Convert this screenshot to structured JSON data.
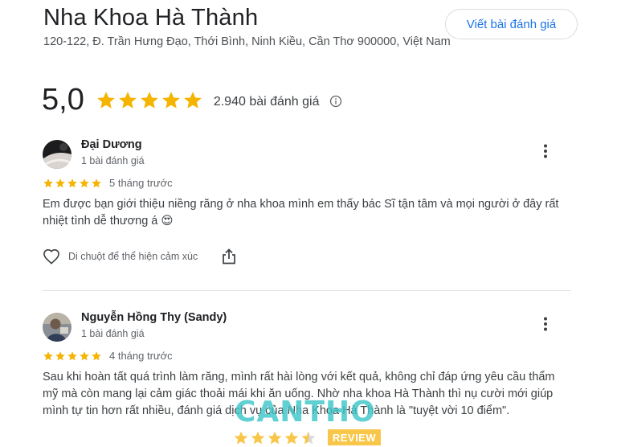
{
  "business": {
    "name": "Nha Khoa Hà Thành",
    "address": "120-122, Đ. Trần Hưng Đạo, Thới Bình, Ninh Kiều, Cần Thơ 900000, Việt Nam",
    "write_review_label": "Viết bài đánh giá",
    "rating": "5,0",
    "rating_stars": 5,
    "review_count": "2.940 bài đánh giá"
  },
  "reviews": [
    {
      "name": "Đại Dương",
      "meta": "1 bài đánh giá",
      "stars": 5,
      "time": "5 tháng trước",
      "text": "Em được bạn giới thiệu niềng răng ở nha khoa mình em thấy bác Sĩ tận tâm và mọi người ở đây rất nhiệt tình dễ thương á 😍",
      "like_label": "Di chuột để thể hiện cảm xúc"
    },
    {
      "name": "Nguyễn Hồng Thy (Sandy)",
      "meta": "1 bài đánh giá",
      "stars": 5,
      "time": "4 tháng trước",
      "text": "Sau khi hoàn tất quá trình làm răng, mình rất hài lòng với kết quả, không chỉ đáp ứng yêu cầu thẩm mỹ mà còn mang lại cảm giác thoải mái khi ăn uống. Nhờ nha khoa Hà Thành thì nụ cười mới giúp mình tự tin hơn rất nhiều, đánh giá dịch vụ của Nha Khoa Hà Thành là \"tuyệt vời 10 điểm\"."
    }
  ],
  "watermark": {
    "text": "CANTHO",
    "badge": "REVIEW",
    "stars": 4.5
  },
  "colors": {
    "star": "#f4b400",
    "link": "#1a73e8",
    "watermark_text": "#3ec6c9",
    "watermark_badge": "#f8c649"
  }
}
